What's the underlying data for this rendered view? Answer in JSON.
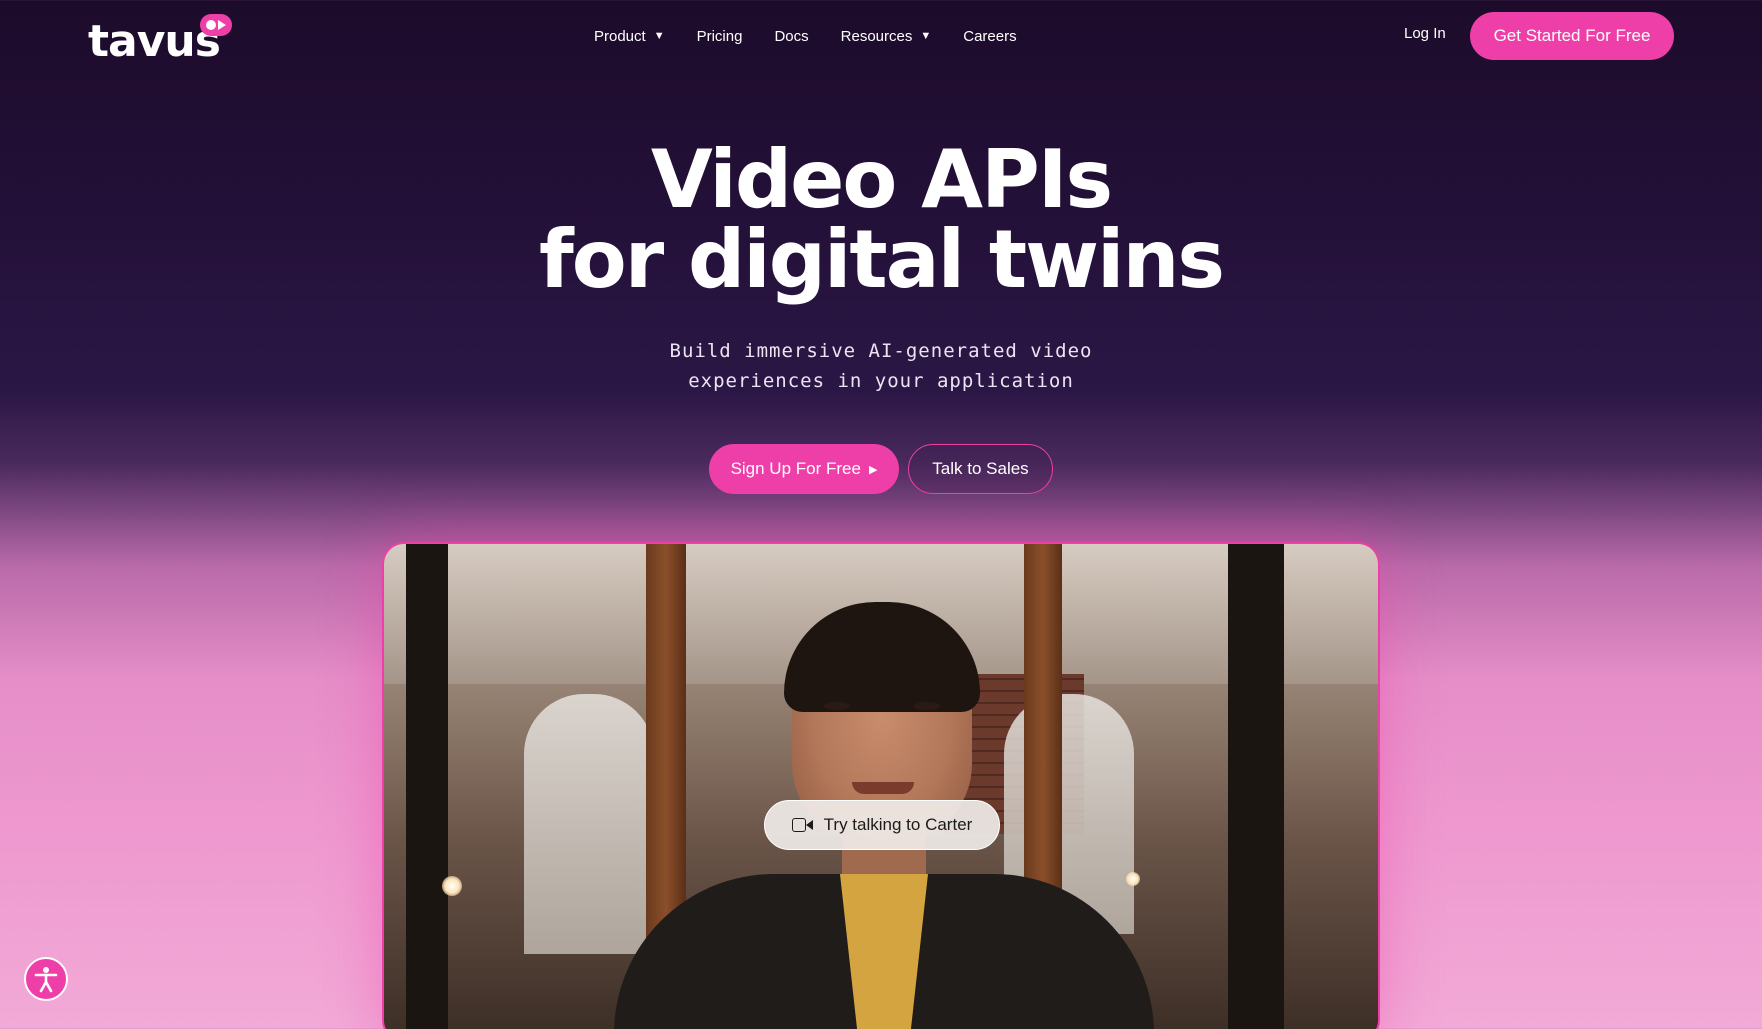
{
  "brand": {
    "name": "tavus",
    "accent": "#ee3fa8"
  },
  "nav": {
    "items": [
      {
        "label": "Product",
        "has_dropdown": true
      },
      {
        "label": "Pricing",
        "has_dropdown": false
      },
      {
        "label": "Docs",
        "has_dropdown": false
      },
      {
        "label": "Resources",
        "has_dropdown": true
      },
      {
        "label": "Careers",
        "has_dropdown": false
      }
    ],
    "caret": "▼",
    "login": "Log In",
    "cta": "Get Started For Free"
  },
  "hero": {
    "title_line1": "Video APIs",
    "title_line2": "for digital twins",
    "subtitle_line1": "Build immersive AI-generated video",
    "subtitle_line2": "experiences in your application",
    "primary_cta": "Sign Up For Free",
    "primary_cta_icon": "▶",
    "secondary_cta": "Talk to Sales"
  },
  "video": {
    "prompt": "Try talking to Carter",
    "prompt_icon": "video-camera-icon"
  },
  "accessibility": {
    "icon": "accessibility-person-icon"
  }
}
